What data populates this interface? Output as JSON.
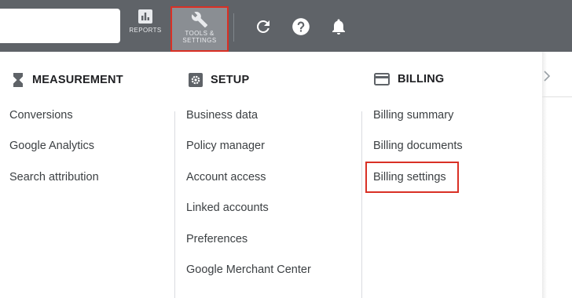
{
  "toolbar": {
    "reports_label": "REPORTS",
    "tools_label_line1": "TOOLS &",
    "tools_label_line2": "SETTINGS"
  },
  "menu": {
    "measurement": {
      "heading": "MEASUREMENT",
      "items": [
        "Conversions",
        "Google Analytics",
        "Search attribution"
      ]
    },
    "setup": {
      "heading": "SETUP",
      "items": [
        "Business data",
        "Policy manager",
        "Account access",
        "Linked accounts",
        "Preferences",
        "Google Merchant Center"
      ]
    },
    "billing": {
      "heading": "BILLING",
      "items": [
        "Billing summary",
        "Billing documents",
        "Billing settings"
      ]
    }
  },
  "colors": {
    "topbar": "#5f6368",
    "highlight": "#d93025",
    "text": "#3c4043"
  }
}
